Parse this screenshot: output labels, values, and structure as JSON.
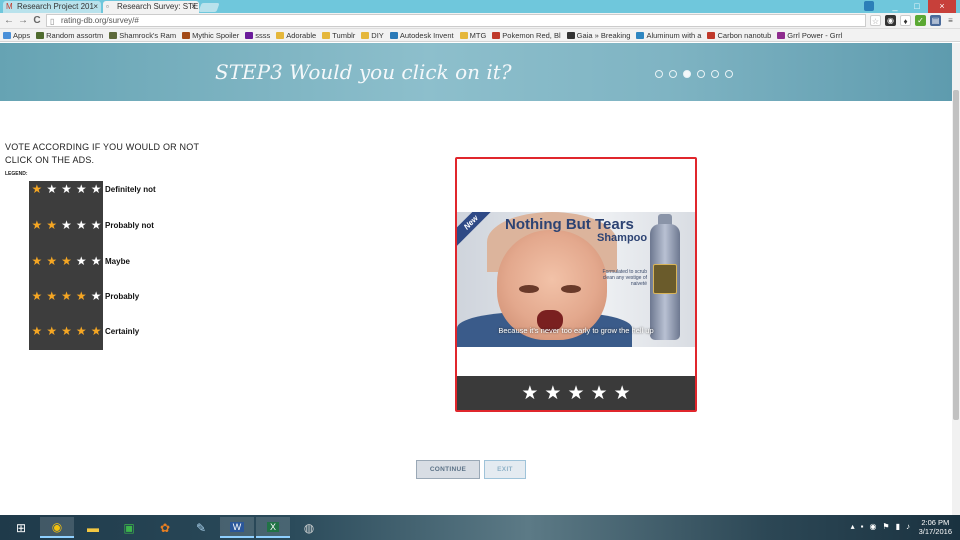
{
  "browser": {
    "tabs": [
      {
        "label": "Research Project 201",
        "icon": "gmail-icon"
      },
      {
        "label": "Research Survey: STE",
        "icon": "page-icon"
      }
    ],
    "tab_close": "×",
    "url": "rating-db.org/survey/#",
    "window_buttons": {
      "minimize": "_",
      "maximize": "□",
      "close": "×"
    },
    "nav": {
      "back": "←",
      "forward": "→",
      "reload": "C"
    },
    "bookmarks": [
      {
        "label": "Apps",
        "color": "#4a90d9"
      },
      {
        "label": "Random assortm",
        "color": "#4f6b2e"
      },
      {
        "label": "Shamrock's Ram",
        "color": "#5d6a3b"
      },
      {
        "label": "Mythic Spoiler",
        "color": "#a34a17"
      },
      {
        "label": "ssss",
        "color": "#6a1b9a"
      },
      {
        "label": "Adorable",
        "color": "#e5b73b"
      },
      {
        "label": "Tumblr",
        "color": "#e5b73b"
      },
      {
        "label": "DIY",
        "color": "#e5b73b"
      },
      {
        "label": "Autodesk Invent",
        "color": "#2a7ab8"
      },
      {
        "label": "MTG",
        "color": "#e5b73b"
      },
      {
        "label": "Pokemon Red, Bl",
        "color": "#c0392b"
      },
      {
        "label": "Gaia » Breaking",
        "color": "#333333"
      },
      {
        "label": "Aluminum with a",
        "color": "#2e86c1"
      },
      {
        "label": "Carbon nanotub",
        "color": "#c0392b"
      },
      {
        "label": "Grrl Power - Grrl",
        "color": "#8e2c8e"
      }
    ]
  },
  "survey": {
    "step_title": "STEP3 Would you click on it?",
    "progress": {
      "total": 6,
      "current": 3
    },
    "instructions": "VOTE ACCORDING IF YOU WOULD OR NOT CLICK ON THE ADS.",
    "legend_label": "LEGEND:",
    "legend": [
      {
        "stars": 1,
        "label": "Definitely not"
      },
      {
        "stars": 2,
        "label": "Probably not"
      },
      {
        "stars": 3,
        "label": "Maybe"
      },
      {
        "stars": 4,
        "label": "Probably"
      },
      {
        "stars": 5,
        "label": "Certainly"
      }
    ],
    "star_glyph": "★",
    "ad": {
      "ribbon": "New",
      "brand": "Nothing But Tears",
      "product": "Shampoo",
      "claim": "Formulated to scrub clean any vestige of naiveté",
      "tagline": "Because it's never too early to grow the hell up"
    },
    "rating": {
      "max": 5,
      "selected": 0
    },
    "continue_label": "CONTINUE",
    "exit_label": "EXIT"
  },
  "taskbar": {
    "apps": [
      "start-icon",
      "chrome-icon",
      "file-explorer-icon",
      "store-icon",
      "picasa-icon",
      "notepad-icon",
      "word-icon",
      "excel-icon",
      "paint-icon"
    ],
    "time": "2:06 PM",
    "date": "3/17/2016"
  },
  "colors": {
    "accent_red": "#e0262c",
    "star_gold": "#f5a623",
    "hero": "#7fb4c3"
  }
}
